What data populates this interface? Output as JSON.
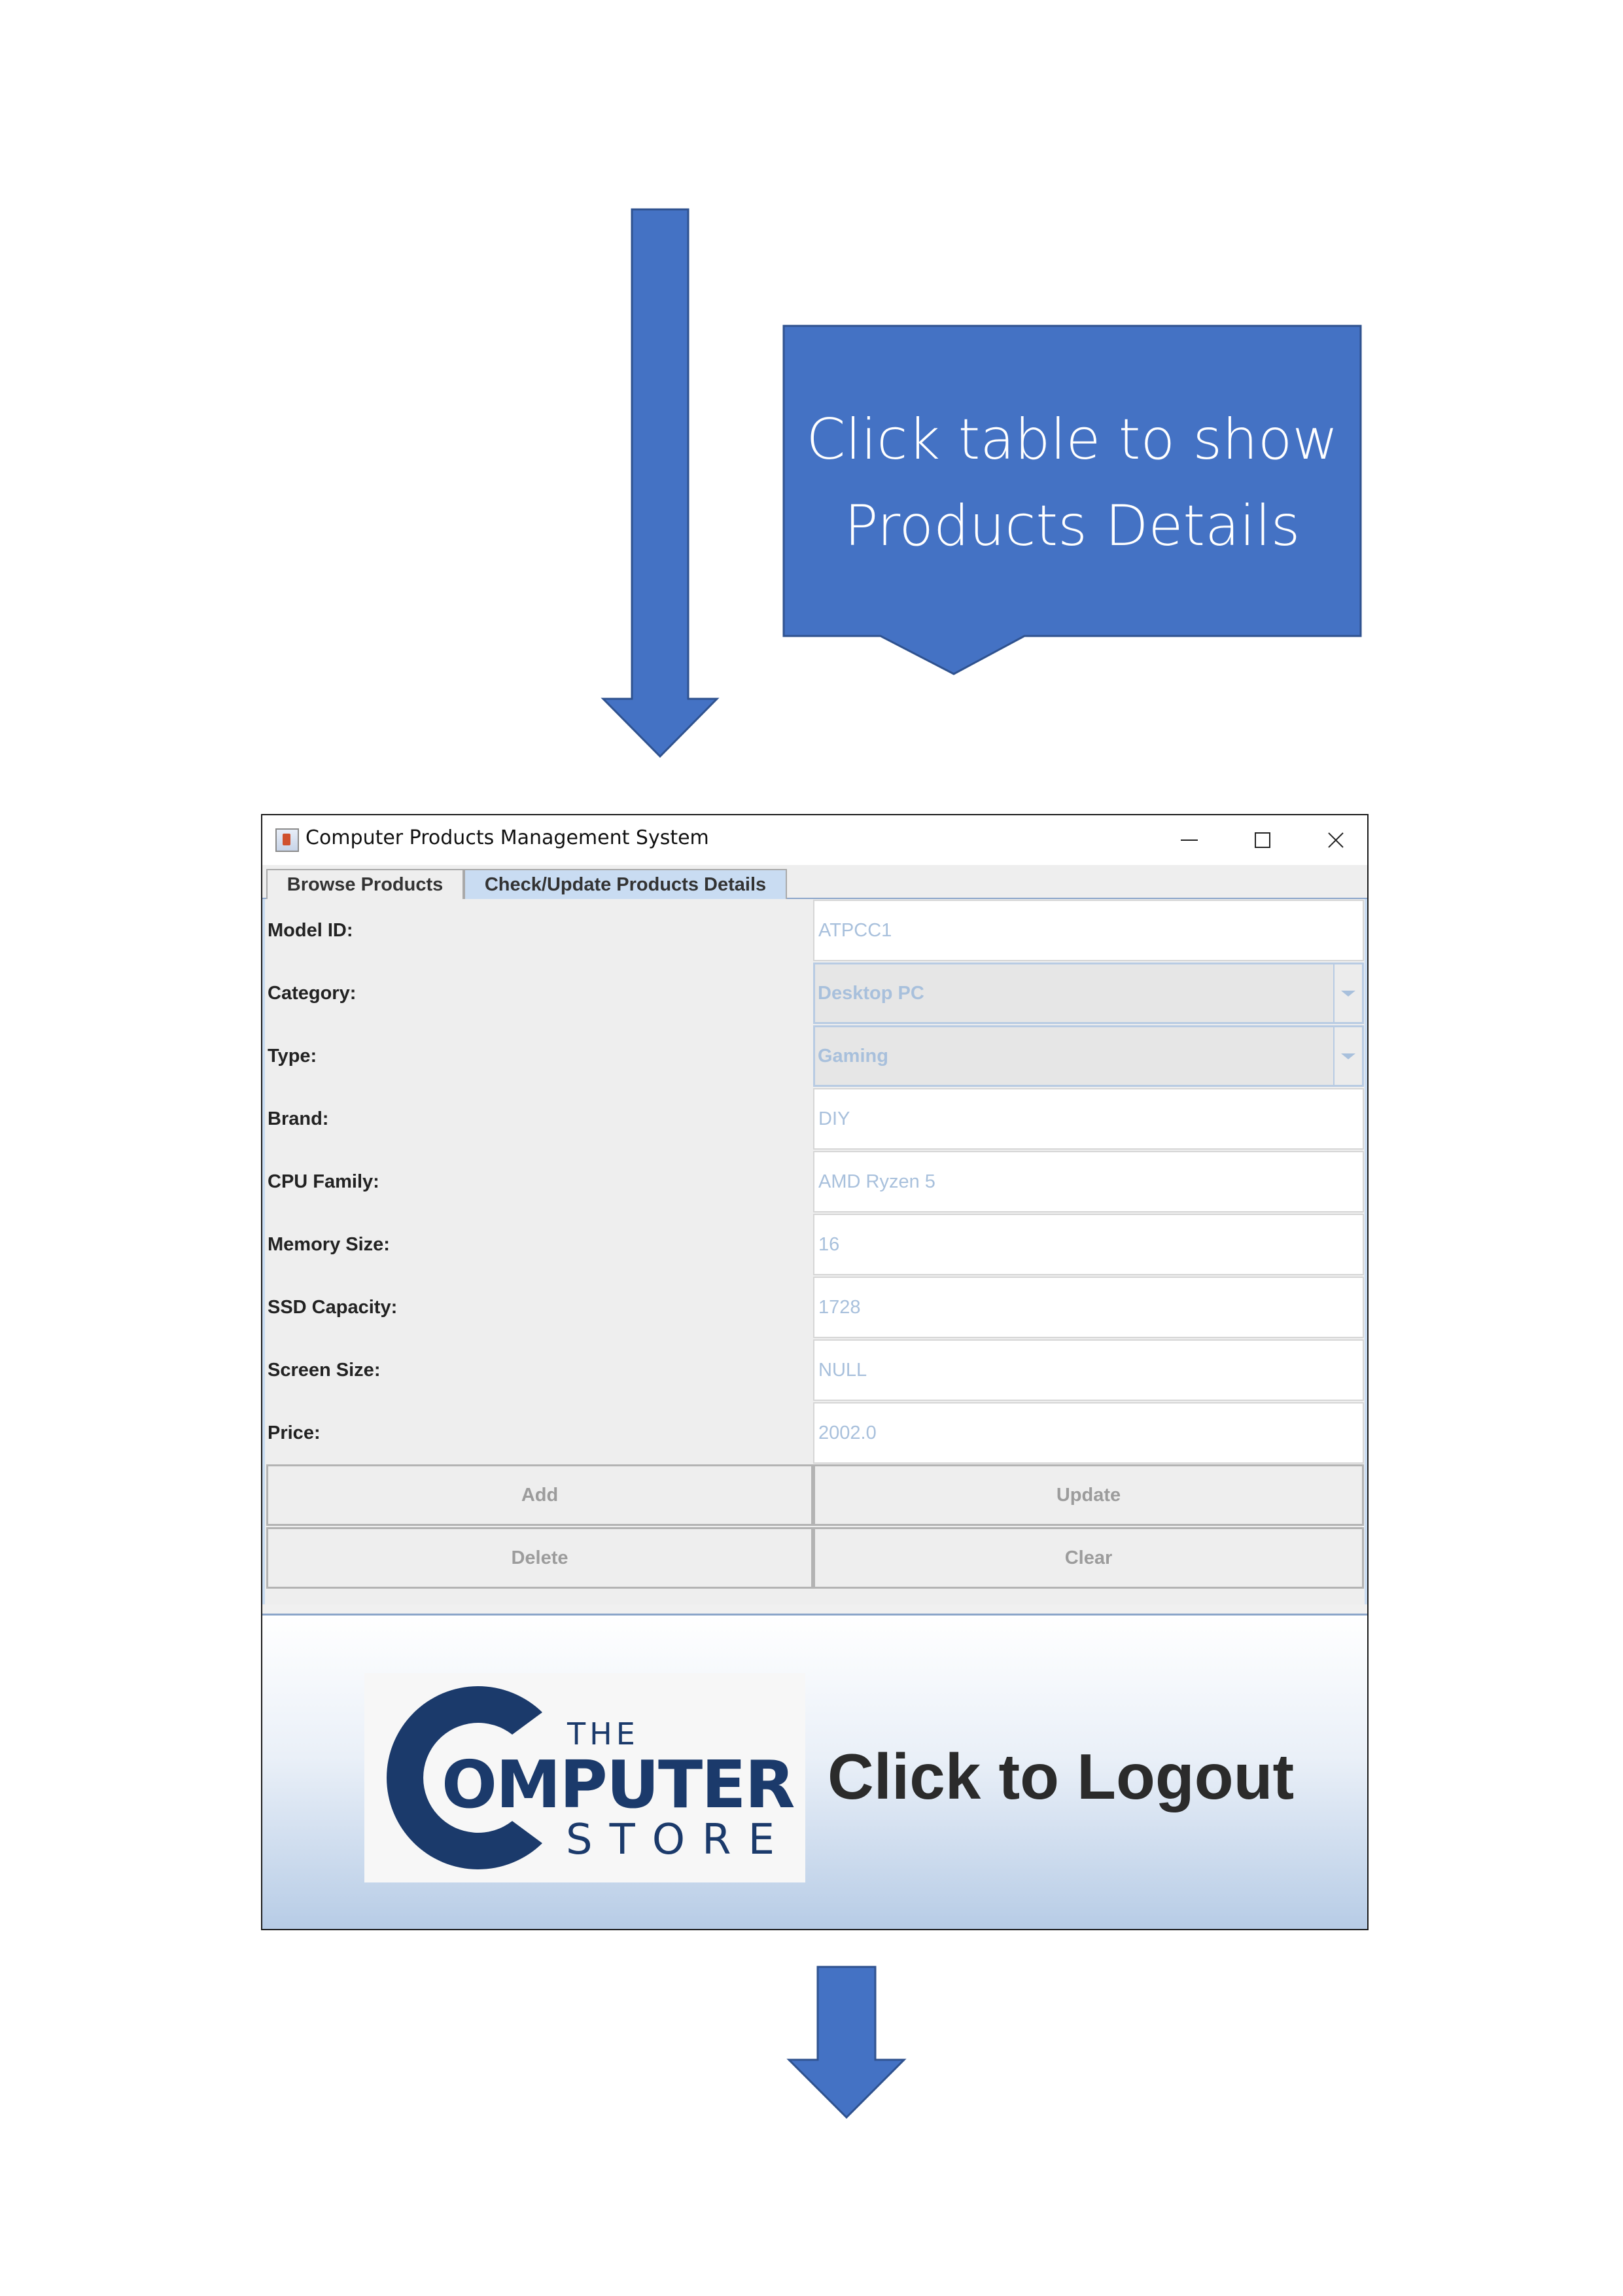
{
  "callout": {
    "text_line1": "Click table to show",
    "text_line2": "Products Details"
  },
  "colors": {
    "annotation_blue": "#4472c4",
    "logo_navy": "#1b3a6b",
    "tab_active": "#c9dcf2",
    "field_text": "#a8c0dc"
  },
  "window": {
    "title": "Computer Products Management System",
    "icon": "java-cup-icon",
    "controls": {
      "minimize": "minimize-icon",
      "maximize": "maximize-icon",
      "close": "close-icon"
    }
  },
  "tabs": [
    {
      "label": "Browse Products",
      "active": false
    },
    {
      "label": "Check/Update Products Details",
      "active": true
    }
  ],
  "form": {
    "model_id": {
      "label": "Model ID:",
      "value": "ATPCC1"
    },
    "category": {
      "label": "Category:",
      "value": "Desktop PC"
    },
    "type": {
      "label": "Type:",
      "value": "Gaming"
    },
    "brand": {
      "label": "Brand:",
      "value": "DIY"
    },
    "cpu_family": {
      "label": "CPU Family:",
      "value": "AMD Ryzen 5"
    },
    "memory_size": {
      "label": "Memory Size:",
      "value": "16"
    },
    "ssd_capacity": {
      "label": "SSD Capacity:",
      "value": "1728"
    },
    "screen_size": {
      "label": "Screen Size:",
      "value": "NULL"
    },
    "price": {
      "label": "Price:",
      "value": "2002.0"
    }
  },
  "buttons": {
    "add": "Add",
    "update": "Update",
    "delete": "Delete",
    "clear": "Clear"
  },
  "logout": {
    "label": "Click to Logout",
    "logo": {
      "the": "THE",
      "omputer": "OMPUTER",
      "store": "STORE"
    }
  }
}
